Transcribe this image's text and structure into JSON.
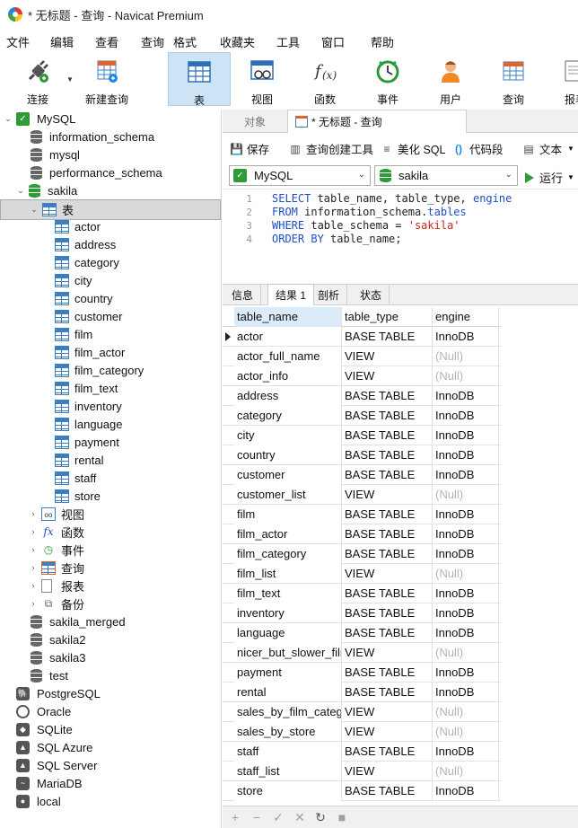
{
  "window": {
    "title": "* 无标题 - 查询 - Navicat Premium"
  },
  "menu": [
    "文件",
    "编辑",
    "查看",
    "查询",
    "格式",
    "收藏夹",
    "工具",
    "窗口",
    "帮助"
  ],
  "toolbar": {
    "connect": "连接",
    "new_query": "新建查询",
    "table": "表",
    "view": "视图",
    "function": "函数",
    "event": "事件",
    "user": "用户",
    "query": "查询",
    "report": "报表"
  },
  "tree": {
    "mysql": "MySQL",
    "dbs_top": [
      "information_schema",
      "mysql",
      "performance_schema"
    ],
    "sakila": "sakila",
    "tables_node": "表",
    "tables": [
      "actor",
      "address",
      "category",
      "city",
      "country",
      "customer",
      "film",
      "film_actor",
      "film_category",
      "film_text",
      "inventory",
      "language",
      "payment",
      "rental",
      "staff",
      "store"
    ],
    "views": "视图",
    "functions": "函数",
    "events": "事件",
    "queries": "查询",
    "reports": "报表",
    "backups": "备份",
    "dbs_bottom": [
      "sakila_merged",
      "sakila2",
      "sakila3",
      "test"
    ],
    "connections": [
      "PostgreSQL",
      "Oracle",
      "SQLite",
      "SQL Azure",
      "SQL Server",
      "MariaDB",
      "local"
    ]
  },
  "tabs": {
    "objects": "对象",
    "query": "* 无标题 - 查询"
  },
  "query_toolbar": {
    "save": "保存",
    "builder": "查询创建工具",
    "beautify": "美化 SQL",
    "snippet": "代码段",
    "text": "文本"
  },
  "selectors": {
    "connection": "MySQL",
    "database": "sakila",
    "run": "运行"
  },
  "sql": {
    "line_numbers": [
      "1",
      "2",
      "3",
      "4"
    ],
    "l1": {
      "kw1": "SELECT",
      "t1": " table_name, table_type, ",
      "kw2": "engine"
    },
    "l2": {
      "kw1": "FROM",
      "t1": " information_schema.",
      "kw2": "tables"
    },
    "l3": {
      "kw1": "WHERE",
      "t1": " table_schema = ",
      "str": "'sakila'"
    },
    "l4": {
      "kw1": "ORDER BY",
      "t1": " table_name;"
    }
  },
  "result_tabs": [
    "信息",
    "结果 1",
    "剖析",
    "状态"
  ],
  "grid": {
    "columns": [
      "table_name",
      "table_type",
      "engine"
    ],
    "rows": [
      [
        "actor",
        "BASE TABLE",
        "InnoDB"
      ],
      [
        "actor_full_name",
        "VIEW",
        "(Null)"
      ],
      [
        "actor_info",
        "VIEW",
        "(Null)"
      ],
      [
        "address",
        "BASE TABLE",
        "InnoDB"
      ],
      [
        "category",
        "BASE TABLE",
        "InnoDB"
      ],
      [
        "city",
        "BASE TABLE",
        "InnoDB"
      ],
      [
        "country",
        "BASE TABLE",
        "InnoDB"
      ],
      [
        "customer",
        "BASE TABLE",
        "InnoDB"
      ],
      [
        "customer_list",
        "VIEW",
        "(Null)"
      ],
      [
        "film",
        "BASE TABLE",
        "InnoDB"
      ],
      [
        "film_actor",
        "BASE TABLE",
        "InnoDB"
      ],
      [
        "film_category",
        "BASE TABLE",
        "InnoDB"
      ],
      [
        "film_list",
        "VIEW",
        "(Null)"
      ],
      [
        "film_text",
        "BASE TABLE",
        "InnoDB"
      ],
      [
        "inventory",
        "BASE TABLE",
        "InnoDB"
      ],
      [
        "language",
        "BASE TABLE",
        "InnoDB"
      ],
      [
        "nicer_but_slower_film_list",
        "VIEW",
        "(Null)"
      ],
      [
        "payment",
        "BASE TABLE",
        "InnoDB"
      ],
      [
        "rental",
        "BASE TABLE",
        "InnoDB"
      ],
      [
        "sales_by_film_category",
        "VIEW",
        "(Null)"
      ],
      [
        "sales_by_store",
        "VIEW",
        "(Null)"
      ],
      [
        "staff",
        "BASE TABLE",
        "InnoDB"
      ],
      [
        "staff_list",
        "VIEW",
        "(Null)"
      ],
      [
        "store",
        "BASE TABLE",
        "InnoDB"
      ]
    ]
  },
  "statusbar": {
    "icons": [
      "add-icon",
      "delete-icon",
      "apply-icon",
      "cancel-icon",
      "refresh-icon",
      "stop-icon"
    ]
  }
}
